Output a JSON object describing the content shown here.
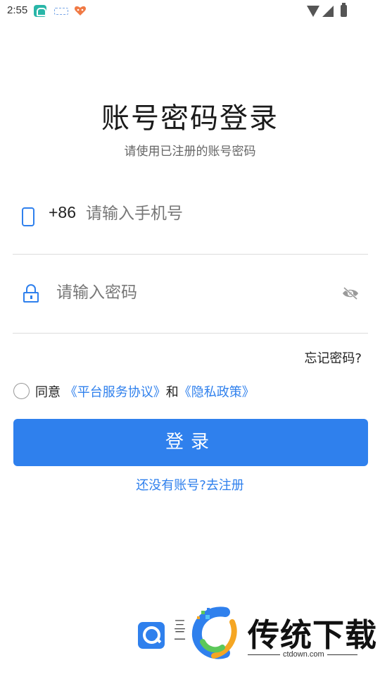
{
  "status_bar": {
    "time": "2:55",
    "icons": [
      "app-notification-icon",
      "glasses-icon",
      "heart-app-icon",
      "wifi-icon",
      "signal-icon",
      "battery-icon"
    ]
  },
  "header": {
    "title": "账号密码登录",
    "subtitle": "请使用已注册的账号密码"
  },
  "phone": {
    "country_code": "+86",
    "placeholder": "请输入手机号",
    "value": ""
  },
  "password": {
    "placeholder": "请输入密码",
    "value": ""
  },
  "forgot_label": "忘记密码?",
  "agreement": {
    "checked": false,
    "prefix": "同意",
    "platform_link": "《平台服务协议》",
    "and": "和",
    "privacy_link": "《隐私政策》"
  },
  "login_label": "登录",
  "register_label": "还没有账号?去注册",
  "watermark": {
    "fragment": "三二",
    "brand": "传统下载",
    "domain": "ctdown.com"
  },
  "colors": {
    "accent": "#2f80ed",
    "background": "#ffffff",
    "text": "#222222",
    "muted": "#777777",
    "divider": "#dcdcdc"
  }
}
